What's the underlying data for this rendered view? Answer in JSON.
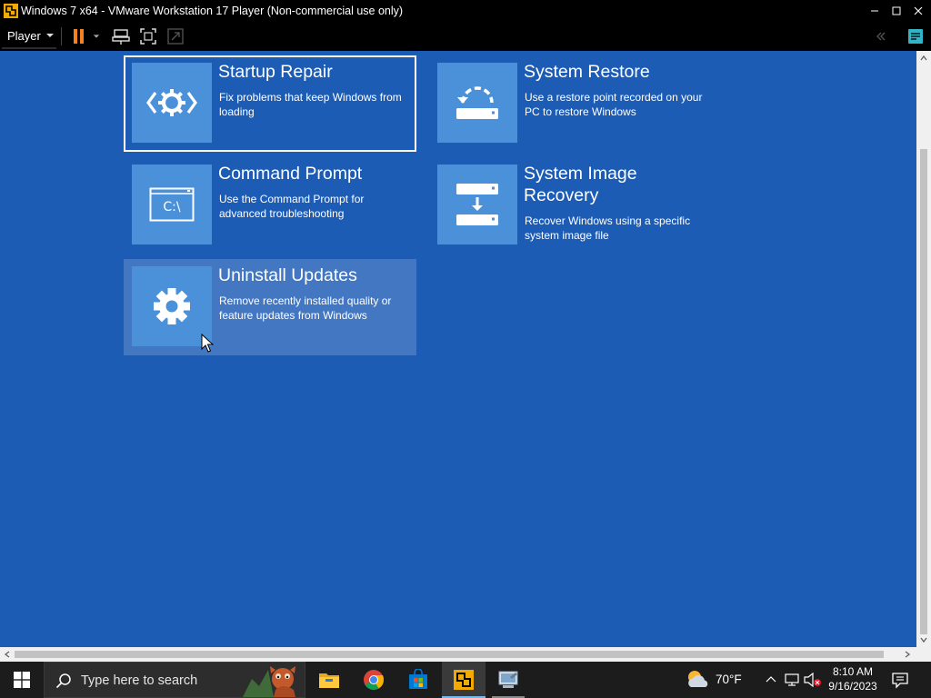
{
  "window": {
    "title": "Windows 7 x64 - VMware Workstation 17 Player (Non-commercial use only)"
  },
  "toolbar": {
    "player_menu_label": "Player",
    "icons": [
      "pause-icon",
      "dropdown-icon",
      "send-ctrl-alt-del-icon",
      "fullscreen-icon",
      "unity-icon",
      "back-icon",
      "notes-icon"
    ]
  },
  "recovery": {
    "tiles": [
      {
        "title": "Startup Repair",
        "description": "Fix problems that keep Windows from loading",
        "icon": "startup-repair-icon",
        "state": "selected"
      },
      {
        "title": "System Restore",
        "description": "Use a restore point recorded on your PC to restore Windows",
        "icon": "system-restore-icon",
        "state": "normal"
      },
      {
        "title": "Command Prompt",
        "description": "Use the Command Prompt for advanced troubleshooting",
        "icon": "command-prompt-icon",
        "icon_text": "C:\\",
        "state": "normal"
      },
      {
        "title": "System Image Recovery",
        "description": "Recover Windows using a specific system image file",
        "icon": "system-image-icon",
        "state": "normal"
      },
      {
        "title": "Uninstall Updates",
        "description": "Remove recently installed quality or feature updates from Windows",
        "icon": "gear-icon",
        "state": "hovered"
      }
    ]
  },
  "taskbar": {
    "search_placeholder": "Type here to search",
    "apps": [
      "file-explorer-icon",
      "chrome-icon",
      "microsoft-store-icon",
      "vmware-player-icon",
      "system-app-icon"
    ],
    "active_app": "vmware-player-icon",
    "weather_temp": "70°F",
    "clock_time": "8:10 AM",
    "clock_date": "9/16/2023"
  },
  "colors": {
    "vm_background": "#1d5cb5",
    "tile_icon": "#4a91d9",
    "taskbar": "#1c1c1c",
    "accent": "#76b9ed"
  }
}
